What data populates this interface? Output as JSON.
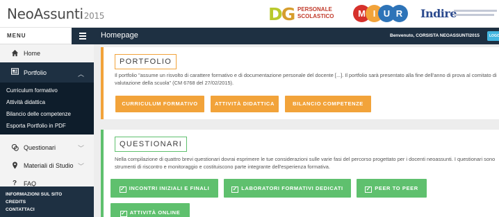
{
  "header": {
    "brand": "NeoAssunti",
    "brand_year": "2015",
    "logos": {
      "dg_text": "DG",
      "dg_line1": "PERSONALE",
      "dg_line2": "SCOLASTICO",
      "miur_letters": [
        "M",
        "I",
        "U",
        "R"
      ],
      "miur_colors": [
        "#d6312c",
        "#f2a33a",
        "#2e74b8",
        "#2e74b8"
      ],
      "indire_word": "Indire"
    }
  },
  "sidebar": {
    "menu_label": "MENU",
    "items": [
      {
        "label": "Home",
        "icon": "home-icon"
      },
      {
        "label": "Portfolio",
        "icon": "portfolio-icon",
        "active": true
      },
      {
        "label": "Questionari",
        "icon": "questionari-icon"
      },
      {
        "label": "Materiali di Studio",
        "icon": "map-marker-icon"
      },
      {
        "label": "FAQ",
        "icon": "question-icon"
      }
    ],
    "submenu": [
      "Curriculum formativo",
      "Attività didattica",
      "Bilancio delle competenze",
      "Esporta Portfolio in PDF"
    ],
    "footer_links": [
      "INFORMAZIONI SUL SITO",
      "CREDITS",
      "CONTATTACI"
    ]
  },
  "topbar": {
    "title": "Homepage",
    "welcome_prefix": "Benvenuto,",
    "user": "CORSISTA NEOASSUNTI2015",
    "logout": "LOGOUT"
  },
  "portfolio": {
    "title": "PORTFOLIO",
    "description": "Il portfolio \"assume un risvolto di carattere formativo e di documentazione personale del docente [...]. Il portfolio sarà presentato alla fine dell'anno di prova al comitato di valutazione della scuola\" (CM 6768 del 27/02/2015).",
    "buttons": [
      "CURRICULUM FORMATIVO",
      "ATTIVITÀ DIDATTICA",
      "BILANCIO COMPETENZE"
    ]
  },
  "questionari": {
    "title": "QUESTIONARI",
    "description": "Nella compilazione di quattro brevi questionari dovrai esprimere le tue considerazioni sulle varie fasi del percorso progettato per i docenti neoassunti. I questionari sono strumenti di riscontro e monitoraggio e costituiscono parte integrante dell'esperienza formativa.",
    "buttons": [
      "INCONTRI INIZIALI E FINALI",
      "LABORATORI FORMATIVI DEDICATI",
      "PEER TO PEER",
      "ATTIVITÀ ONLINE"
    ]
  },
  "colors": {
    "navy": "#1e3042",
    "orange": "#f2a33a",
    "green": "#5fc06e",
    "accent_blue": "#43b6e0"
  }
}
